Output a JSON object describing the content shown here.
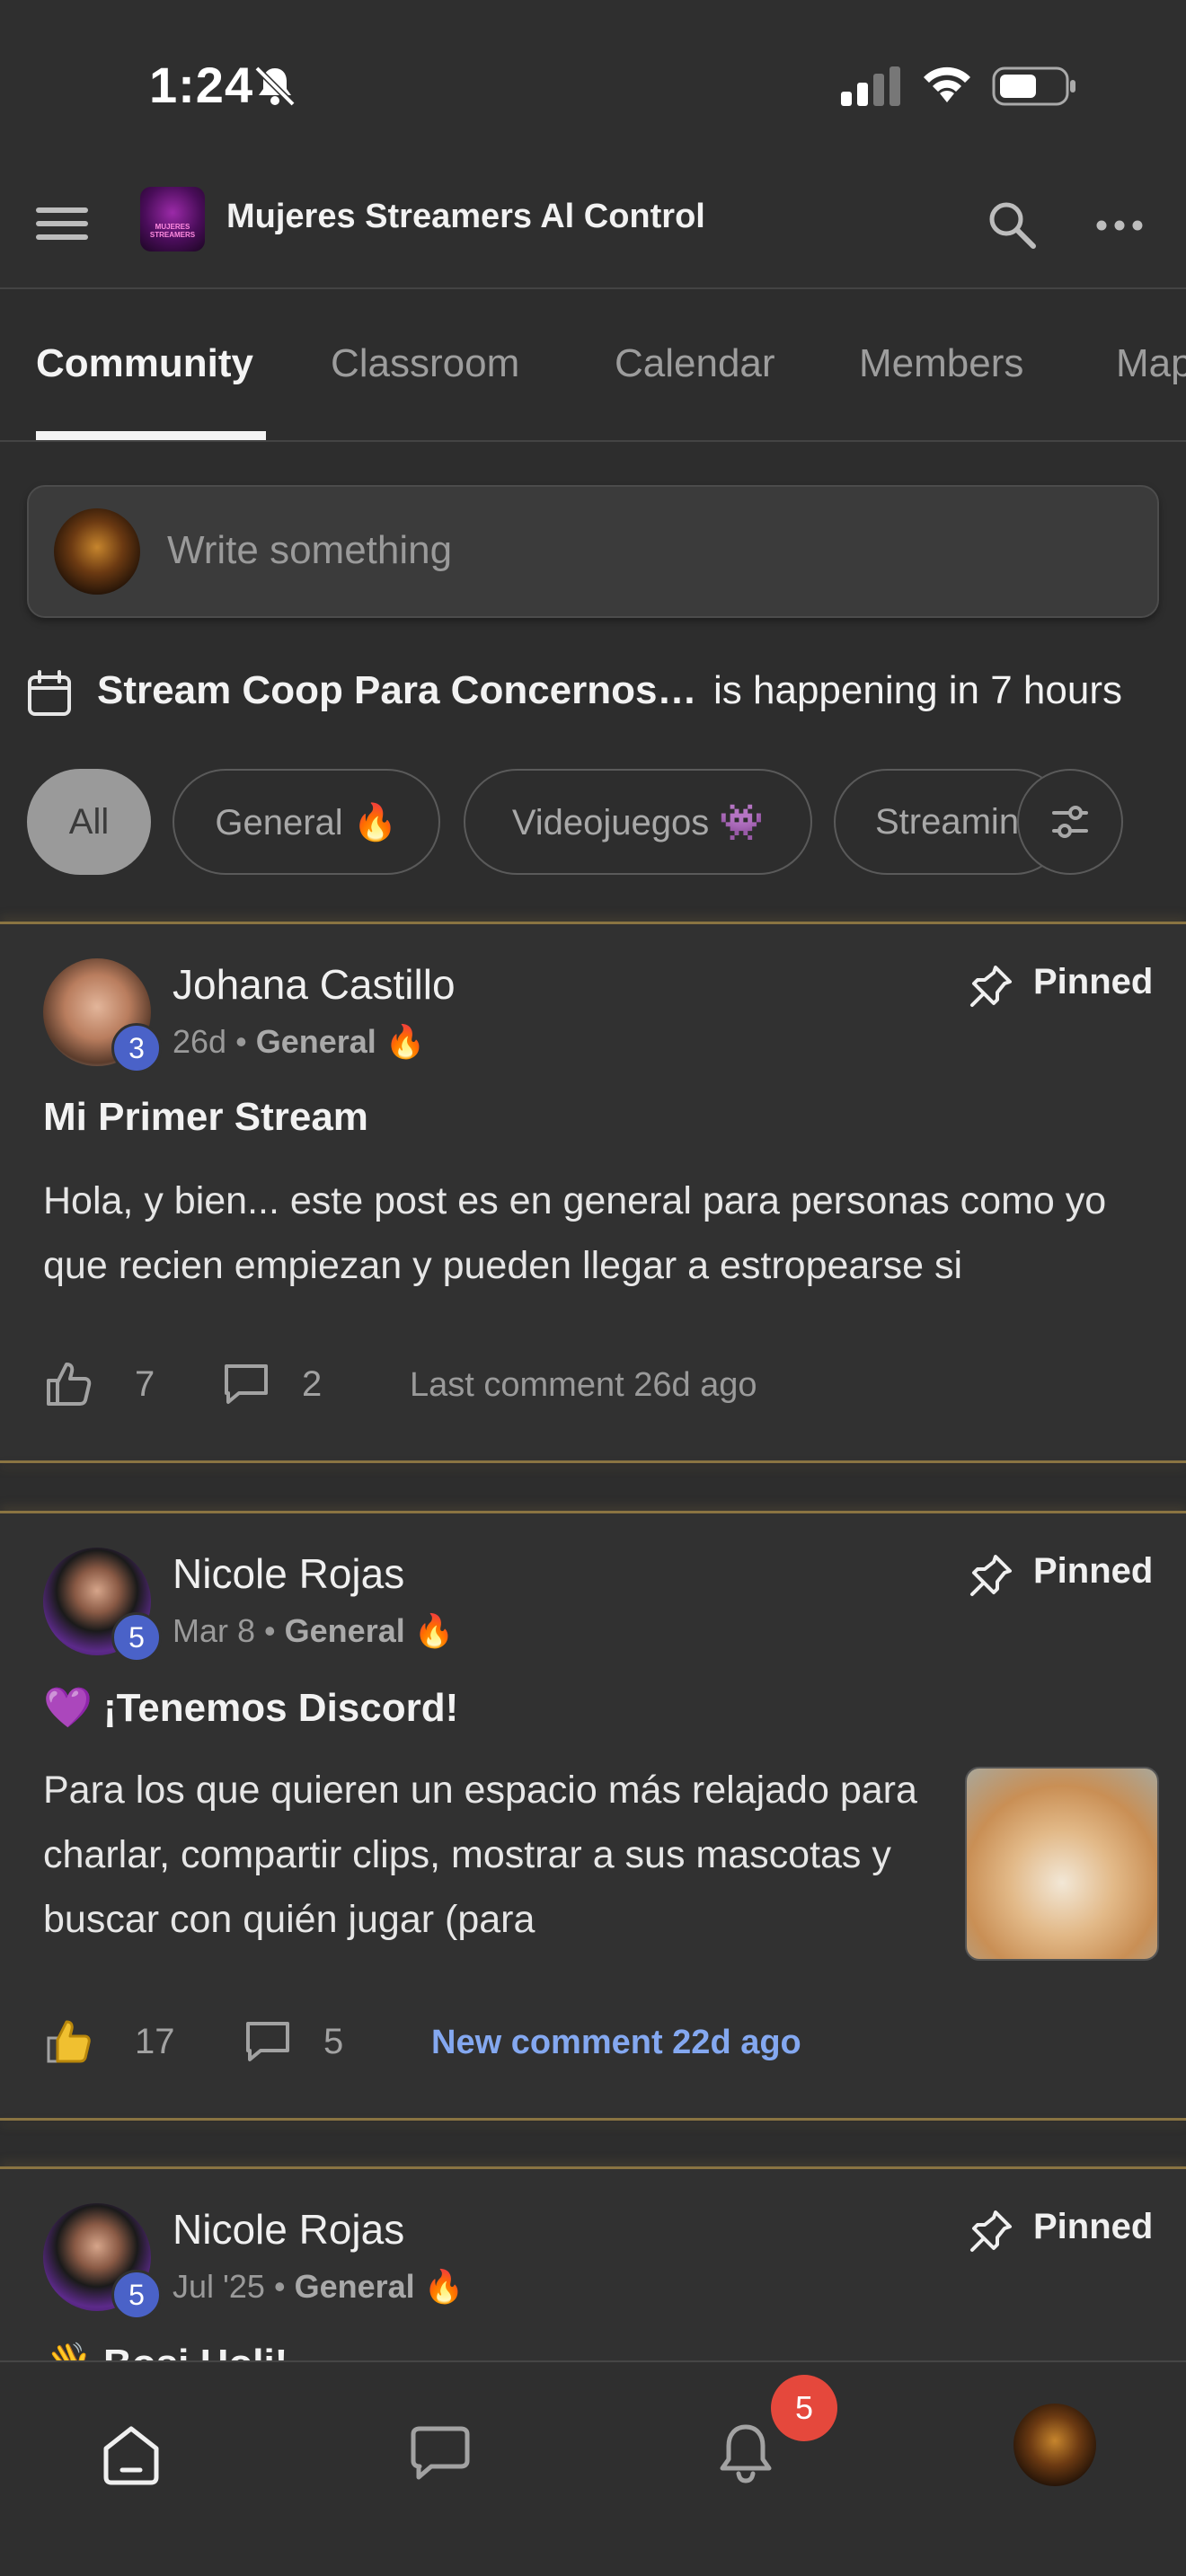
{
  "status_bar": {
    "time": "1:24"
  },
  "header": {
    "title": "Mujeres Streamers Al Control",
    "logo_text": "MUJERES STREAMERS"
  },
  "tabs": [
    {
      "label": "Community",
      "active": true
    },
    {
      "label": "Classroom",
      "active": false
    },
    {
      "label": "Calendar",
      "active": false
    },
    {
      "label": "Members",
      "active": false
    },
    {
      "label": "Map",
      "active": false
    }
  ],
  "composer": {
    "placeholder": "Write something"
  },
  "event": {
    "name": "Stream Coop Para Concernos…",
    "when": "is happening in 7 hours"
  },
  "filters": [
    {
      "label": "All",
      "active": true
    },
    {
      "label": "General 🔥",
      "active": false
    },
    {
      "label": "Videojuegos 👾",
      "active": false
    },
    {
      "label": "Streaming",
      "active": false
    }
  ],
  "posts": [
    {
      "author": "Johana Castillo",
      "level": "3",
      "time": "26d",
      "category": "General 🔥",
      "pinned_label": "Pinned",
      "title": "Mi Primer Stream",
      "body": "Hola, y bien... este post es en general para personas como yo que recien empiezan y pueden llegar a estropearse si",
      "likes": "7",
      "comments": "2",
      "last_comment": "Last comment 26d ago",
      "liked": false
    },
    {
      "author": "Nicole Rojas",
      "level": "5",
      "time": "Mar 8",
      "category": "General 🔥",
      "pinned_label": "Pinned",
      "title": "💜 ¡Tenemos Discord!",
      "body": "Para los que quieren un espacio más relajado para charlar, compartir clips, mostrar a sus mascotas y buscar con quién jugar (para",
      "likes": "17",
      "comments": "5",
      "last_comment": "New comment 22d ago",
      "liked": true
    },
    {
      "author": "Nicole Rojas",
      "level": "5",
      "time": "Jul '25",
      "category": "General 🔥",
      "pinned_label": "Pinned",
      "title": "👋 Bosi Holi!"
    }
  ],
  "bottom_nav": {
    "notifications_count": "5"
  },
  "colors": {
    "accent_gold": "#8a7442",
    "link_blue": "#84a8f0",
    "badge_red": "#e5483c",
    "level_blue": "#4a62c8"
  }
}
